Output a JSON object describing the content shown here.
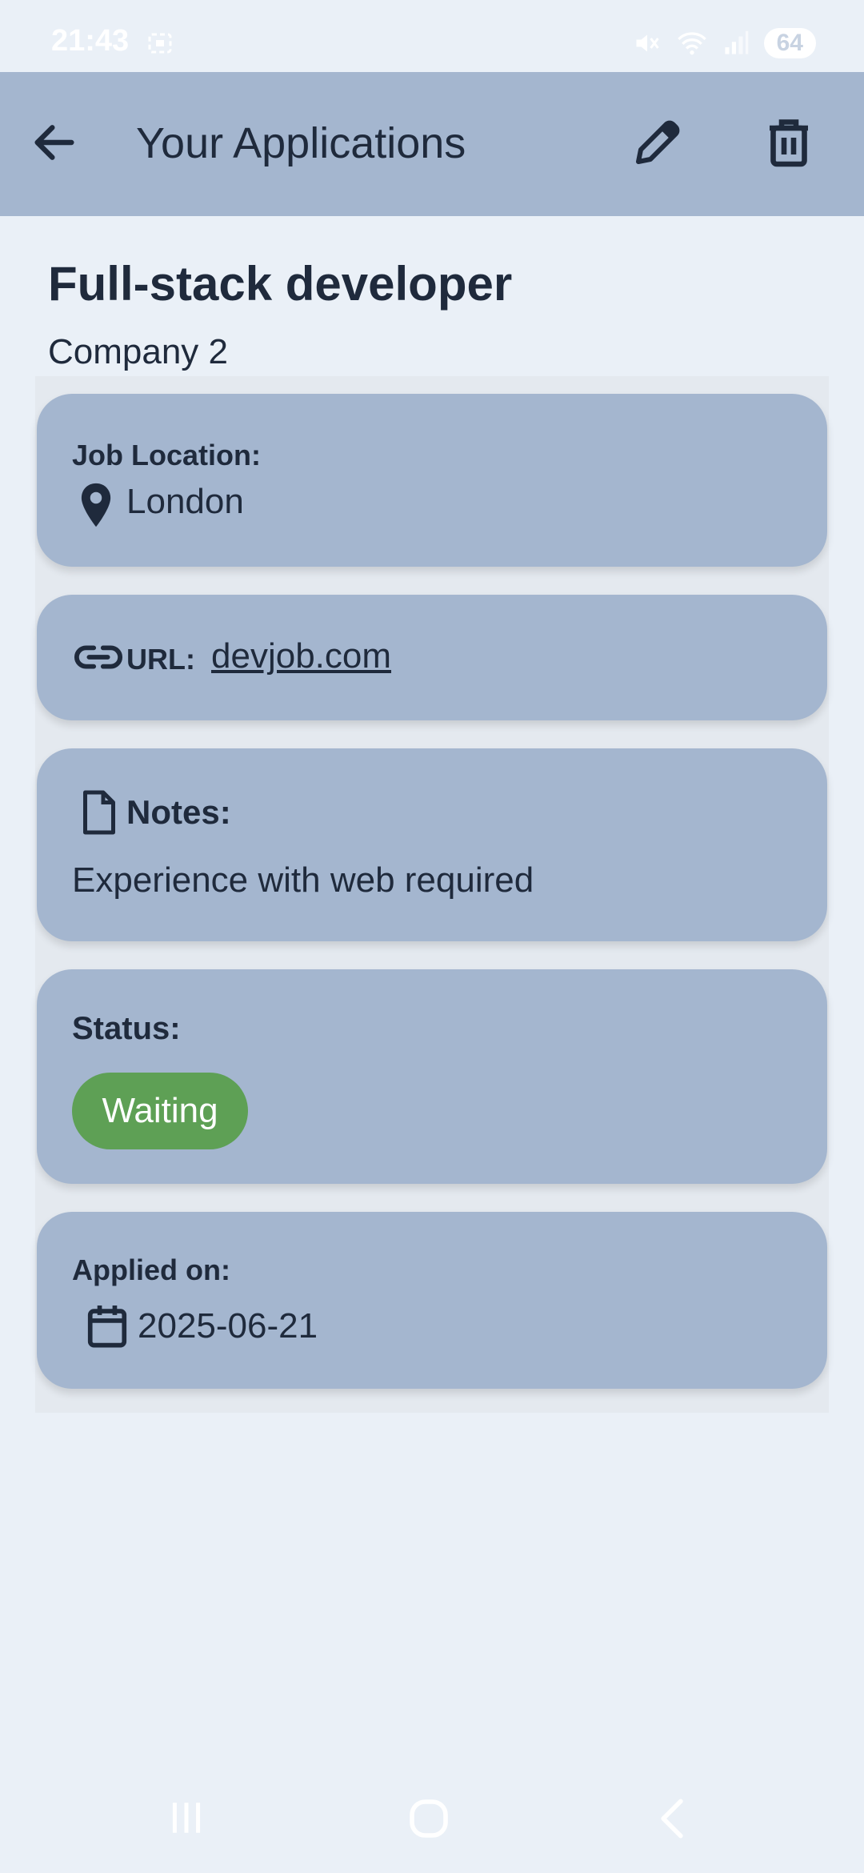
{
  "status_bar": {
    "time": "21:43",
    "battery": "64"
  },
  "app_bar": {
    "title": "Your Applications"
  },
  "job": {
    "title": "Full-stack developer",
    "company": "Company 2"
  },
  "location": {
    "label": "Job Location:",
    "value": "London"
  },
  "url": {
    "label": "URL:",
    "value": "devjob.com"
  },
  "notes": {
    "label": "Notes:",
    "value": "Experience with web required"
  },
  "status": {
    "label": "Status:",
    "value": "Waiting",
    "color": "#5ea055"
  },
  "applied": {
    "label": "Applied on:",
    "value": "2025-06-21"
  },
  "colors": {
    "background": "#eaf0f7",
    "card": "#a4b6cf",
    "text": "#1f2a3c"
  }
}
